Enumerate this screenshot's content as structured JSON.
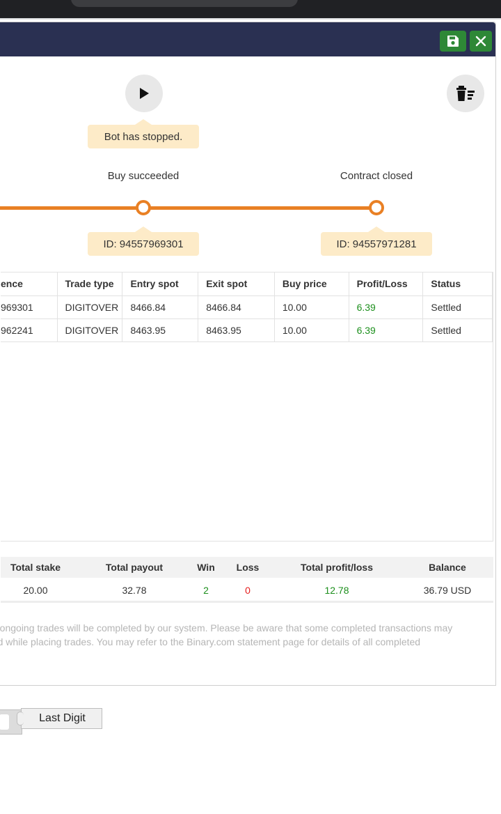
{
  "header": {
    "save_icon": "floppy-disk-icon",
    "close_icon": "close-icon",
    "accent": "#2e8836",
    "bar_color": "#2a3052"
  },
  "controls": {
    "run_icon": "play-icon",
    "clear_icon": "trash-list-icon",
    "status_text": "Bot has stopped."
  },
  "timeline": {
    "steps": [
      {
        "label": "Buy succeeded",
        "id_text": "ID: 94557969301"
      },
      {
        "label": "Contract closed",
        "id_text": "ID: 94557971281"
      }
    ],
    "line_color": "#e98024"
  },
  "transactions": {
    "columns": [
      "ence",
      "Trade type",
      "Entry spot",
      "Exit spot",
      "Buy price",
      "Profit/Loss",
      "Status"
    ],
    "rows": [
      {
        "ref": "969301",
        "type": "DIGITOVER",
        "entry": "8466.84",
        "exit": "8466.84",
        "buy": "10.00",
        "pl": "6.39",
        "status": "Settled"
      },
      {
        "ref": "962241",
        "type": "DIGITOVER",
        "entry": "8463.95",
        "exit": "8463.95",
        "buy": "10.00",
        "pl": "6.39",
        "status": "Settled"
      }
    ]
  },
  "summary": {
    "headers": {
      "stake": "Total stake",
      "payout": "Total payout",
      "win": "Win",
      "loss": "Loss",
      "pl": "Total profit/loss",
      "balance": "Balance"
    },
    "values": {
      "stake": "20.00",
      "payout": "32.78",
      "win": "2",
      "loss": "0",
      "pl": "12.78",
      "balance": "36.79 USD"
    }
  },
  "disclaimer": {
    "line1": "ny ongoing trades will be completed by our system. Please be aware that some completed transactions may",
    "line2": "ped while placing trades. You may refer to the Binary.com statement page for details of all completed"
  },
  "workspace": {
    "block_label": "Last Digit"
  }
}
